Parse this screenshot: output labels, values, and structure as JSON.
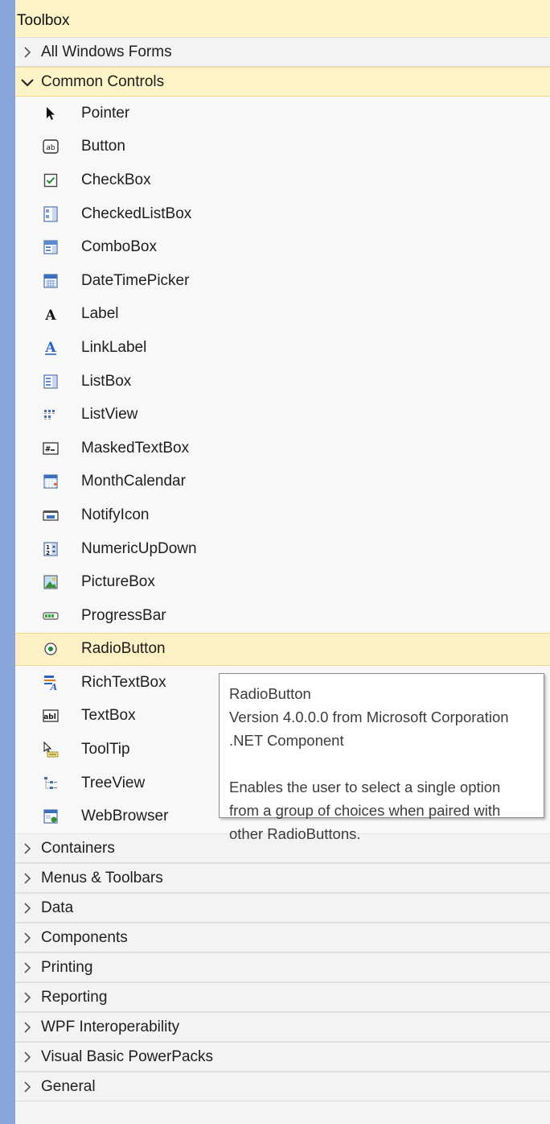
{
  "toolbox": {
    "title": "Toolbox",
    "categories_top": [
      {
        "label": "All Windows Forms",
        "expanded": false
      }
    ],
    "expanded_category": {
      "label": "Common Controls",
      "items": [
        {
          "label": "Pointer",
          "icon": "pointer-icon"
        },
        {
          "label": "Button",
          "icon": "button-icon"
        },
        {
          "label": "CheckBox",
          "icon": "checkbox-icon"
        },
        {
          "label": "CheckedListBox",
          "icon": "checkedlistbox-icon"
        },
        {
          "label": "ComboBox",
          "icon": "combobox-icon"
        },
        {
          "label": "DateTimePicker",
          "icon": "datetimepicker-icon"
        },
        {
          "label": "Label",
          "icon": "label-icon"
        },
        {
          "label": "LinkLabel",
          "icon": "linklabel-icon"
        },
        {
          "label": "ListBox",
          "icon": "listbox-icon"
        },
        {
          "label": "ListView",
          "icon": "listview-icon"
        },
        {
          "label": "MaskedTextBox",
          "icon": "maskedtextbox-icon"
        },
        {
          "label": "MonthCalendar",
          "icon": "monthcalendar-icon"
        },
        {
          "label": "NotifyIcon",
          "icon": "notifyicon-icon"
        },
        {
          "label": "NumericUpDown",
          "icon": "numericupdown-icon"
        },
        {
          "label": "PictureBox",
          "icon": "picturebox-icon"
        },
        {
          "label": "ProgressBar",
          "icon": "progressbar-icon"
        },
        {
          "label": "RadioButton",
          "icon": "radiobutton-icon",
          "selected": true
        },
        {
          "label": "RichTextBox",
          "icon": "richtextbox-icon"
        },
        {
          "label": "TextBox",
          "icon": "textbox-icon"
        },
        {
          "label": "ToolTip",
          "icon": "tooltip-icon"
        },
        {
          "label": "TreeView",
          "icon": "treeview-icon"
        },
        {
          "label": "WebBrowser",
          "icon": "webbrowser-icon"
        }
      ]
    },
    "categories_bottom": [
      {
        "label": "Containers"
      },
      {
        "label": "Menus & Toolbars"
      },
      {
        "label": "Data"
      },
      {
        "label": "Components"
      },
      {
        "label": "Printing"
      },
      {
        "label": "Reporting"
      },
      {
        "label": "WPF Interoperability"
      },
      {
        "label": "Visual Basic PowerPacks"
      },
      {
        "label": "General"
      }
    ]
  },
  "tooltip": {
    "name": "RadioButton",
    "version": "Version 4.0.0.0 from Microsoft Corporation",
    "component": ".NET Component",
    "desc_line1": "Enables the user to select a single option",
    "desc_line2": "from a group of choices when paired with",
    "desc_line3": "other RadioButtons."
  },
  "colors": {
    "sidebar_bg": "#8aa5dc",
    "highlight": "#fff3c8",
    "panel_bg": "#f5f5f5"
  }
}
